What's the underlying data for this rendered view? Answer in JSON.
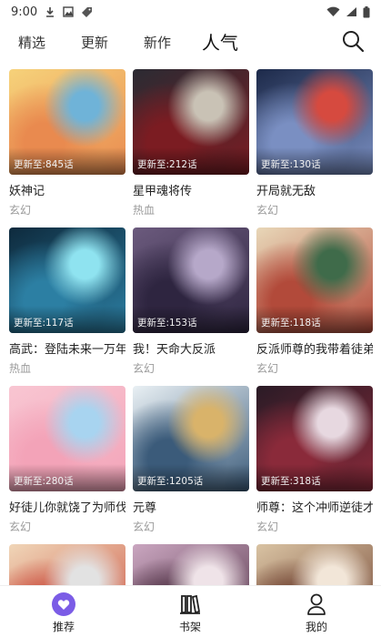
{
  "status_bar": {
    "time": "9:00",
    "icons": [
      "download-icon",
      "image-icon",
      "tag-icon",
      "wifi-icon",
      "signal-icon",
      "battery-icon"
    ]
  },
  "tabs": [
    {
      "label": "精选",
      "active": false
    },
    {
      "label": "更新",
      "active": false
    },
    {
      "label": "新作",
      "active": false
    },
    {
      "label": "人气",
      "active": true
    }
  ],
  "comics": [
    {
      "title": "妖神记",
      "genre": "玄幻",
      "update": "更新至:845话",
      "colors": [
        "#f6d27a",
        "#e98a4f",
        "#6fb3d8"
      ]
    },
    {
      "title": "星甲魂将传",
      "genre": "热血",
      "update": "更新至:212话",
      "colors": [
        "#2b2b33",
        "#7b1c22",
        "#c9c2b5"
      ]
    },
    {
      "title": "开局就无敌",
      "genre": "玄幻",
      "update": "更新至:130话",
      "colors": [
        "#1d2a4a",
        "#7a8fc2",
        "#d64a3f"
      ]
    },
    {
      "title": "高武：登陆未来一万年",
      "genre": "热血",
      "update": "更新至:117话",
      "colors": [
        "#0e2a3d",
        "#2c7fa3",
        "#8fe3f0"
      ]
    },
    {
      "title": "我！天命大反派",
      "genre": "玄幻",
      "update": "更新至:153话",
      "colors": [
        "#6b5a7d",
        "#2e2540",
        "#b6a8c9"
      ]
    },
    {
      "title": "反派师尊的我带着徒弟们天下无敌",
      "genre": "玄幻",
      "update": "更新至:118话",
      "colors": [
        "#e8d7b8",
        "#b24a3a",
        "#3f6b4a"
      ]
    },
    {
      "title": "好徒儿你就饶了为师伐",
      "genre": "玄幻",
      "update": "更新至:280话",
      "colors": [
        "#f8c6d2",
        "#f3a3b8",
        "#a8d4f0"
      ]
    },
    {
      "title": "元尊",
      "genre": "玄幻",
      "update": "更新至:1205话",
      "colors": [
        "#e9f0f4",
        "#3b5b7a",
        "#d9b36a"
      ]
    },
    {
      "title": "师尊：这个冲师逆徒才不是圣子",
      "genre": "玄幻",
      "update": "更新至:318话",
      "colors": [
        "#2a1b26",
        "#8a2a3a",
        "#e7d8e0"
      ]
    },
    {
      "title": "",
      "genre": "",
      "update": "",
      "colors": [
        "#f0d6b8",
        "#c94b3b",
        "#e2e2e2"
      ]
    },
    {
      "title": "",
      "genre": "",
      "update": "",
      "colors": [
        "#caa6c0",
        "#4a2c3f",
        "#efe3e8"
      ]
    },
    {
      "title": "",
      "genre": "",
      "update": "",
      "colors": [
        "#d9c3a3",
        "#6a3b2b",
        "#f2e6d8"
      ]
    }
  ],
  "bottom_nav": [
    {
      "label": "推荐",
      "icon": "heart-icon",
      "active": true
    },
    {
      "label": "书架",
      "icon": "bookshelf-icon",
      "active": false
    },
    {
      "label": "我的",
      "icon": "person-icon",
      "active": false
    }
  ],
  "accent_color": "#7b5ce6"
}
